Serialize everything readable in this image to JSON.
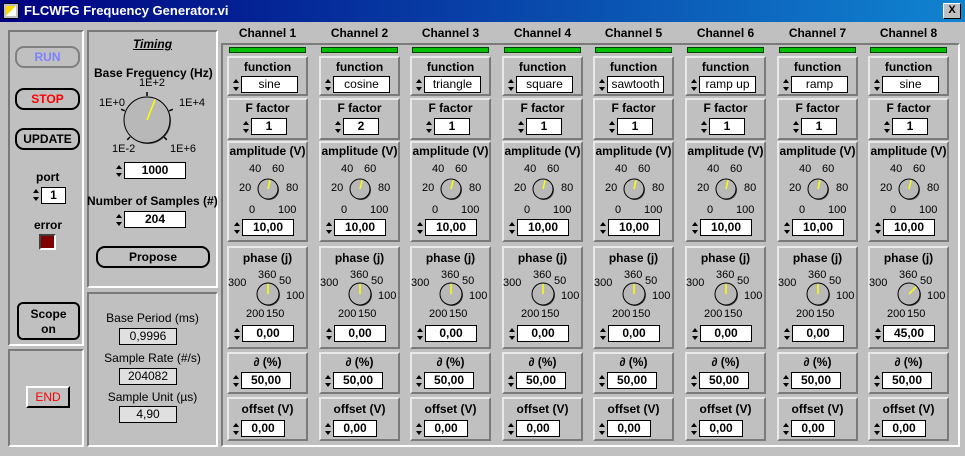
{
  "window": {
    "title": "FLCWFG Frequency Generator.vi",
    "close_label": "X"
  },
  "controls": {
    "run_label": "RUN",
    "stop_label": "STOP",
    "update_label": "UPDATE",
    "port_label": "port",
    "port_value": "1",
    "error_label": "error",
    "scope_label_1": "Scope",
    "scope_label_2": "on",
    "end_label": "END"
  },
  "timing": {
    "title": "Timing",
    "base_freq_label": "Base Frequency (Hz)",
    "base_freq_value": "1000",
    "base_freq_knob": {
      "ticks": [
        "1E+0",
        "1E+2",
        "1E+4",
        "1E-2",
        "1E+6"
      ],
      "value_fraction": 0.58
    },
    "samples_label": "Number of Samples (#)",
    "samples_value": "204",
    "propose_label": "Propose"
  },
  "info": {
    "base_period_label": "Base Period (ms)",
    "base_period_value": "0,9996",
    "sample_rate_label": "Sample Rate (#/s)",
    "sample_rate_value": "204082",
    "sample_unit_label": "Sample Unit (µs)",
    "sample_unit_value": "4,90"
  },
  "labels": {
    "function": "function",
    "ffactor": "F factor",
    "amplitude": "amplitude (V)",
    "phase": "phase (j)",
    "duty": "∂ (%)",
    "offset": "offset (V)",
    "amp_ticks": [
      "40",
      "60",
      "20",
      "80",
      "0",
      "100"
    ],
    "phase_ticks": [
      "360",
      "50",
      "300",
      "100",
      "200",
      "150"
    ]
  },
  "channels": [
    {
      "name": "Channel 1",
      "function": "sine",
      "ffactor": "1",
      "amplitude": "10,00",
      "amp_frac": 0.55,
      "phase": "0,00",
      "phase_frac": 0.0,
      "duty": "50,00",
      "offset": "0,00"
    },
    {
      "name": "Channel 2",
      "function": "cosine",
      "ffactor": "2",
      "amplitude": "10,00",
      "amp_frac": 0.55,
      "phase": "0,00",
      "phase_frac": 0.0,
      "duty": "50,00",
      "offset": "0,00"
    },
    {
      "name": "Channel 3",
      "function": "triangle",
      "ffactor": "1",
      "amplitude": "10,00",
      "amp_frac": 0.55,
      "phase": "0,00",
      "phase_frac": 0.0,
      "duty": "50,00",
      "offset": "0,00"
    },
    {
      "name": "Channel 4",
      "function": "square",
      "ffactor": "1",
      "amplitude": "10,00",
      "amp_frac": 0.55,
      "phase": "0,00",
      "phase_frac": 0.0,
      "duty": "50,00",
      "offset": "0,00"
    },
    {
      "name": "Channel 5",
      "function": "sawtooth",
      "ffactor": "1",
      "amplitude": "10,00",
      "amp_frac": 0.55,
      "phase": "0,00",
      "phase_frac": 0.0,
      "duty": "50,00",
      "offset": "0,00"
    },
    {
      "name": "Channel 6",
      "function": "ramp up",
      "ffactor": "1",
      "amplitude": "10,00",
      "amp_frac": 0.55,
      "phase": "0,00",
      "phase_frac": 0.0,
      "duty": "50,00",
      "offset": "0,00"
    },
    {
      "name": "Channel 7",
      "function": "ramp",
      "ffactor": "1",
      "amplitude": "10,00",
      "amp_frac": 0.55,
      "phase": "0,00",
      "phase_frac": 0.0,
      "duty": "50,00",
      "offset": "0,00"
    },
    {
      "name": "Channel 8",
      "function": "sine",
      "ffactor": "1",
      "amplitude": "10,00",
      "amp_frac": 0.55,
      "phase": "45,00",
      "phase_frac": 0.125,
      "duty": "50,00",
      "offset": "0,00"
    }
  ],
  "colors": {
    "title_bar": "#000080",
    "led_on": "#00c000",
    "knob_pointer": "#ffff00",
    "button_red_text": "#ff0000",
    "run_text": "#8080ff"
  }
}
